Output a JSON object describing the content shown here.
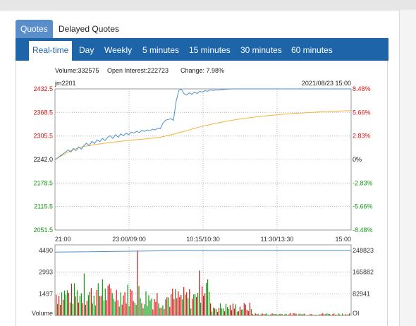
{
  "tabs": [
    {
      "label": "Quotes",
      "active": true
    },
    {
      "label": "Delayed Quotes",
      "active": false
    }
  ],
  "nav": [
    {
      "label": "Real-time",
      "active": true
    },
    {
      "label": "Day",
      "active": false
    },
    {
      "label": "Weekly",
      "active": false
    },
    {
      "label": "5 minutes",
      "active": false
    },
    {
      "label": "15 minutes",
      "active": false
    },
    {
      "label": "30 minutes",
      "active": false
    },
    {
      "label": "60 minutes",
      "active": false
    }
  ],
  "info": {
    "volume": "Volume:332575",
    "open_interest": "Open Interest:222723",
    "change": "Change: 7.98%"
  },
  "symbol": "jm2201",
  "datetime": "2021/08/23 15:00",
  "colors": {
    "up": "#dd1111",
    "down": "#119911",
    "price_line": "#4a8fd0",
    "avg_line": "#f2b33a",
    "nav_bg": "#1e64a8",
    "tab_bg": "#5a8ec9"
  },
  "chart_data": {
    "type": "line",
    "price_ticks_left": [
      "2432.5",
      "2368.5",
      "2305.5",
      "2242.0",
      "2178.5",
      "2115.5",
      "2051.5"
    ],
    "price_ticks_right": [
      "8.48%",
      "5.66%",
      "2.83%",
      "0%",
      "-2.83%",
      "-5.66%",
      "-8.48%"
    ],
    "tick_colors": [
      "up",
      "up",
      "up",
      "neutral",
      "down",
      "down",
      "down"
    ],
    "time_ticks": [
      "21:00",
      "23:00/09:00",
      "10:15/10:30",
      "11:30/13:30",
      "15:00"
    ],
    "ylim": [
      2051.5,
      2432.5
    ],
    "base_price": 2242.0,
    "price_series": [
      [
        0,
        2242
      ],
      [
        2,
        2246
      ],
      [
        4,
        2252
      ],
      [
        6,
        2257
      ],
      [
        8,
        2262
      ],
      [
        10,
        2268
      ],
      [
        12,
        2262
      ],
      [
        14,
        2272
      ],
      [
        16,
        2266
      ],
      [
        18,
        2276
      ],
      [
        20,
        2270
      ],
      [
        22,
        2280
      ],
      [
        24,
        2286
      ],
      [
        26,
        2279
      ],
      [
        28,
        2291
      ],
      [
        30,
        2285
      ],
      [
        32,
        2295
      ],
      [
        34,
        2290
      ],
      [
        36,
        2299
      ],
      [
        38,
        2293
      ],
      [
        40,
        2302
      ],
      [
        42,
        2306
      ],
      [
        44,
        2299
      ],
      [
        46,
        2309
      ],
      [
        48,
        2302
      ],
      [
        50,
        2311
      ],
      [
        52,
        2306
      ],
      [
        54,
        2313
      ],
      [
        56,
        2309
      ],
      [
        58,
        2316
      ],
      [
        60,
        2313
      ],
      [
        62,
        2318
      ],
      [
        64,
        2315
      ],
      [
        66,
        2320
      ],
      [
        68,
        2318
      ],
      [
        70,
        2322
      ],
      [
        72,
        2319
      ],
      [
        74,
        2324
      ],
      [
        76,
        2322
      ],
      [
        78,
        2326
      ],
      [
        80,
        2325
      ],
      [
        82,
        2340
      ],
      [
        84,
        2348
      ],
      [
        86,
        2350
      ],
      [
        88,
        2352
      ],
      [
        90,
        2348
      ],
      [
        92,
        2398
      ],
      [
        94,
        2428
      ],
      [
        96,
        2432
      ],
      [
        98,
        2420
      ],
      [
        100,
        2416
      ],
      [
        102,
        2422
      ],
      [
        104,
        2418
      ],
      [
        106,
        2424
      ],
      [
        108,
        2420
      ],
      [
        110,
        2426
      ],
      [
        112,
        2424
      ],
      [
        114,
        2428
      ],
      [
        116,
        2426
      ],
      [
        118,
        2430
      ],
      [
        120,
        2428
      ],
      [
        122,
        2430
      ],
      [
        124,
        2429
      ],
      [
        126,
        2431
      ],
      [
        128,
        2430
      ],
      [
        130,
        2432
      ],
      [
        132,
        2432
      ],
      [
        135,
        2432.5
      ],
      [
        140,
        2432.5
      ],
      [
        150,
        2432.5
      ],
      [
        160,
        2432.5
      ],
      [
        170,
        2432.5
      ],
      [
        180,
        2432.5
      ],
      [
        190,
        2432.5
      ],
      [
        200,
        2432.5
      ],
      [
        210,
        2432.5
      ],
      [
        220,
        2432.5
      ],
      [
        225,
        2432.5
      ]
    ],
    "avg_series": [
      [
        0,
        2242
      ],
      [
        5,
        2252
      ],
      [
        10,
        2262
      ],
      [
        15,
        2270
      ],
      [
        20,
        2276
      ],
      [
        30,
        2282
      ],
      [
        40,
        2287
      ],
      [
        50,
        2291
      ],
      [
        60,
        2295
      ],
      [
        70,
        2298
      ],
      [
        80,
        2302
      ],
      [
        90,
        2310
      ],
      [
        100,
        2320
      ],
      [
        110,
        2330
      ],
      [
        120,
        2338
      ],
      [
        130,
        2345
      ],
      [
        140,
        2351
      ],
      [
        150,
        2356
      ],
      [
        160,
        2360
      ],
      [
        170,
        2363
      ],
      [
        180,
        2366
      ],
      [
        190,
        2368
      ],
      [
        200,
        2370
      ],
      [
        210,
        2372
      ],
      [
        225,
        2374
      ]
    ],
    "volume_ticks_left": [
      "4490",
      "2993",
      "1497"
    ],
    "oi_ticks_right": [
      "248823",
      "165882",
      "82941"
    ],
    "volume_axis_label": "Volume",
    "oi_axis_label": "OI",
    "volume_ylim": [
      0,
      4490
    ],
    "oi_line_start": 4380,
    "oi_line_end": 4470
  }
}
